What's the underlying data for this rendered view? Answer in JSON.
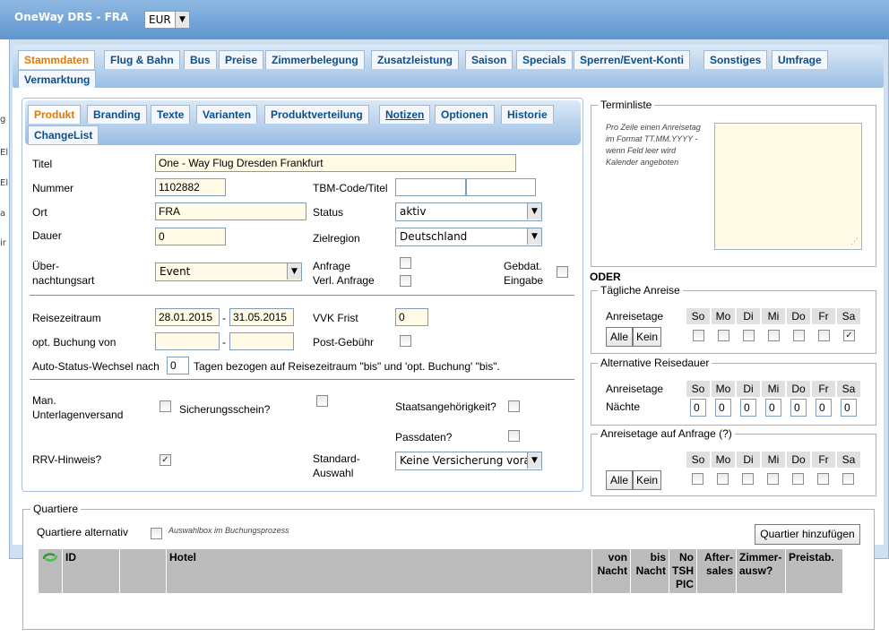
{
  "header": {
    "app_title": "OneWay DRS - FRA",
    "currency": "EUR"
  },
  "edge_fragments": [
    "g",
    "El",
    "El",
    "a",
    "ir"
  ],
  "main_tabs": [
    {
      "label": "Stammdaten",
      "active": true
    },
    {
      "label": "Flug & Bahn"
    },
    {
      "label": "Bus"
    },
    {
      "label": "Preise"
    },
    {
      "label": "Zimmerbelegung"
    },
    {
      "label": "Zusatzleistung"
    },
    {
      "label": "Saison"
    },
    {
      "label": "Specials"
    },
    {
      "label": "Sperren/Event-Konti"
    },
    {
      "label": "Sonstiges"
    },
    {
      "label": "Umfrage"
    },
    {
      "label": "Vermarktung"
    }
  ],
  "sub_tabs": [
    {
      "label": "Produkt",
      "active": true
    },
    {
      "label": "Branding"
    },
    {
      "label": "Texte"
    },
    {
      "label": "Varianten"
    },
    {
      "label": "Produktverteilung"
    },
    {
      "label": "Notizen"
    },
    {
      "label": "Optionen"
    },
    {
      "label": "Historie"
    },
    {
      "label": "ChangeList"
    }
  ],
  "form": {
    "titel_label": "Titel",
    "titel_value": "One - Way Flug Dresden Frankfurt",
    "nummer_label": "Nummer",
    "nummer_value": "1102882",
    "tbm_label": "TBM-Code/Titel",
    "tbm_code": "",
    "tbm_titel": "",
    "ort_label": "Ort",
    "ort_value": "FRA",
    "status_label": "Status",
    "status_value": "aktiv",
    "dauer_label": "Dauer",
    "dauer_value": "0",
    "zielregion_label": "Zielregion",
    "zielregion_value": "Deutschland",
    "uebernachtung_label_1": "Über-",
    "uebernachtung_label_2": "nachtungsart",
    "uebernachtung_value": "Event",
    "anfrage_label": "Anfrage",
    "verl_anfrage_label": "Verl. Anfrage",
    "gebdat_label_1": "Gebdat.",
    "gebdat_label_2": "Eingabe",
    "reisezeitraum_label": "Reisezeitraum",
    "reisezeitraum_from": "28.01.2015",
    "reisezeitraum_to": "31.05.2015",
    "range_sep": "-",
    "vvk_label": "VVK Frist",
    "vvk_value": "0",
    "opt_buchung_label": "opt. Buchung von",
    "opt_buchung_from": "",
    "opt_buchung_to": "",
    "post_gebuehr_label": "Post-Gebühr",
    "auto_status_pre": "Auto-Status-Wechsel nach",
    "auto_status_value": "0",
    "auto_status_post": "Tagen bezogen auf Reisezeitraum \"bis\" und 'opt. Buchung' \"bis\".",
    "man_unterlagen_label_1": "Man.",
    "man_unterlagen_label_2": "Unterlagenversand",
    "sicherungsschein_label": "Sicherungsschein?",
    "staatsangehoerigkeit_label": "Staatsangehörigkeit?",
    "passdaten_label": "Passdaten?",
    "rrv_label": "RRV-Hinweis?",
    "standard_auswahl_label_1": "Standard-",
    "standard_auswahl_label_2": "Auswahl",
    "standard_auswahl_value": "Keine Versicherung vorau"
  },
  "terminliste": {
    "legend": "Terminliste",
    "hint": "Pro Zeile einen Anreisetag im Format TT.MM.YYYY - wenn Feld leer wird Kalender angeboten",
    "value": ""
  },
  "oder_label": "ODER",
  "days": [
    "So",
    "Mo",
    "Di",
    "Mi",
    "Do",
    "Fr",
    "Sa"
  ],
  "taegliche_anreise": {
    "legend": "Tägliche Anreise",
    "anreisetage_label": "Anreisetage",
    "alle_label": "Alle",
    "kein_label": "Kein",
    "checked": [
      false,
      false,
      false,
      false,
      false,
      false,
      true
    ]
  },
  "alternative_reisedauer": {
    "legend": "Alternative Reisedauer",
    "anreisetage_label": "Anreisetage",
    "naechte_label": "Nächte",
    "naechte_values": [
      "0",
      "0",
      "0",
      "0",
      "0",
      "0",
      "0"
    ]
  },
  "anreisetage_auf_anfrage": {
    "legend": "Anreisetage auf Anfrage (?)",
    "alle_label": "Alle",
    "kein_label": "Kein",
    "checked": [
      false,
      false,
      false,
      false,
      false,
      false,
      false
    ]
  },
  "quartiere": {
    "legend": "Quartiere",
    "alternativ_label": "Quartiere alternativ",
    "auswahlbox_hint": "Auswahlbox im Buchungsprozess",
    "add_button": "Quartier hinzufügen",
    "columns": {
      "id": "ID",
      "hotel": "Hotel",
      "von": "von Nacht",
      "bis": "bis Nacht",
      "no_tsh": "No TSH PIC",
      "aftersales": "After- sales",
      "zimmer": "Zimmer- ausw?",
      "preistab": "Preistab."
    }
  }
}
